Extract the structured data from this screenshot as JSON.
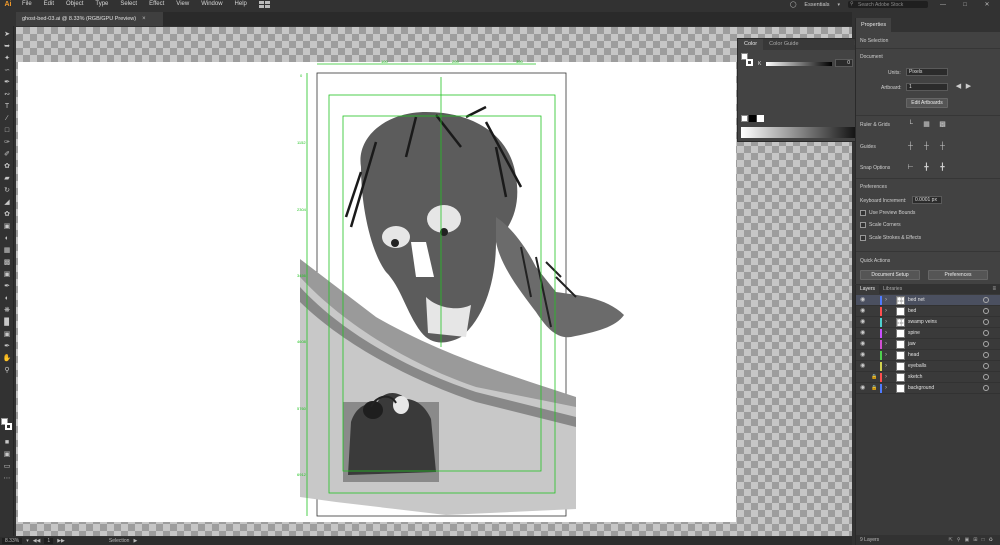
{
  "app": {
    "logo": "Ai"
  },
  "menu": {
    "items": [
      "File",
      "Edit",
      "Object",
      "Type",
      "Select",
      "Effect",
      "View",
      "Window",
      "Help"
    ],
    "workspace": "Essentials",
    "search_placeholder": "Search Adobe Stock"
  },
  "document": {
    "tab_title": "ghost-bed-03.ai @ 8.33% (RGB/GPU Preview)",
    "close_glyph": "×"
  },
  "ruler": {
    "top_ticks": [
      "100",
      "200",
      "300"
    ],
    "left_ticks": [
      "0",
      "1152",
      "2304",
      "3456",
      "4608",
      "5760",
      "6912"
    ]
  },
  "color_panel": {
    "tabs": [
      "Color",
      "Color Guide"
    ],
    "k_label": "K",
    "k_value": "0",
    "percent": "%"
  },
  "properties": {
    "tab": "Properties",
    "no_selection": "No Selection",
    "document_heading": "Document",
    "units_label": "Units:",
    "units_value": "Pixels",
    "artboard_label": "Artboard:",
    "artboard_value": "1",
    "edit_artboards": "Edit Artboards",
    "ruler_grids": "Ruler & Grids",
    "guides": "Guides",
    "snap_options": "Snap Options",
    "preferences_heading": "Preferences",
    "keyboard_increment_label": "Keyboard Increment:",
    "keyboard_increment_value": "0.0001 px",
    "use_preview_bounds": "Use Preview Bounds",
    "scale_corners": "Scale Corners",
    "scale_strokes": "Scale Strokes & Effects",
    "quick_actions": "Quick Actions",
    "document_setup": "Document Setup",
    "preferences_btn": "Preferences"
  },
  "layers_panel": {
    "tabs": [
      "Layers",
      "Libraries"
    ],
    "layers": [
      {
        "name": "bed net",
        "color": "#4f7bff",
        "selected": true,
        "visible": true,
        "locked": false
      },
      {
        "name": "bed",
        "color": "#ff4f4f",
        "selected": false,
        "visible": true,
        "locked": false
      },
      {
        "name": "swamp veins",
        "color": "#4fd1d1",
        "selected": false,
        "visible": true,
        "locked": false
      },
      {
        "name": "spine",
        "color": "#c84fff",
        "selected": false,
        "visible": true,
        "locked": false
      },
      {
        "name": "jaw",
        "color": "#d14fd1",
        "selected": false,
        "visible": true,
        "locked": false
      },
      {
        "name": "head",
        "color": "#4fd14f",
        "selected": false,
        "visible": true,
        "locked": false
      },
      {
        "name": "eyeballs",
        "color": "#d1d14f",
        "selected": false,
        "visible": true,
        "locked": false
      },
      {
        "name": "sketch",
        "color": "#ff4f4f",
        "selected": false,
        "visible": false,
        "locked": true
      },
      {
        "name": "background",
        "color": "#4f7bff",
        "selected": false,
        "visible": true,
        "locked": true
      }
    ],
    "footer_count": "9 Layers"
  },
  "status": {
    "zoom": "8.33%",
    "artboard": "1",
    "tool": "Selection"
  }
}
